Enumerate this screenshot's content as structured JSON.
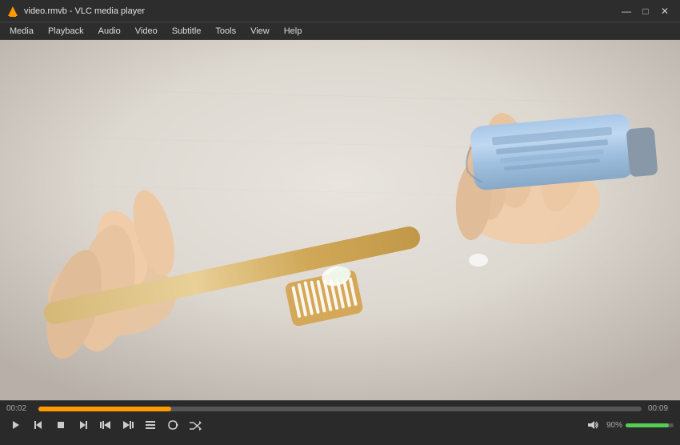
{
  "window": {
    "title": "video.rmvb - VLC media player",
    "icon": "vlc"
  },
  "titlebar": {
    "minimize_label": "—",
    "maximize_label": "□",
    "close_label": "✕"
  },
  "menubar": {
    "items": [
      {
        "id": "media",
        "label": "Media"
      },
      {
        "id": "playback",
        "label": "Playback"
      },
      {
        "id": "audio",
        "label": "Audio"
      },
      {
        "id": "video",
        "label": "Video"
      },
      {
        "id": "subtitle",
        "label": "Subtitle"
      },
      {
        "id": "tools",
        "label": "Tools"
      },
      {
        "id": "view",
        "label": "View"
      },
      {
        "id": "help",
        "label": "Help"
      }
    ]
  },
  "controls": {
    "time_current": "00:02",
    "time_total": "00:09",
    "progress_pct": 22,
    "volume_pct": 90,
    "volume_label": "90%",
    "play_icon": "▶",
    "prev_icon": "⏮",
    "stop_icon": "⏹",
    "next_icon": "⏭",
    "frame_back_icon": "◀|",
    "frame_fwd_icon": "|▶",
    "playlist_icon": "☰",
    "loop_icon": "↺",
    "random_icon": "⤢",
    "volume_icon": "🔊"
  }
}
